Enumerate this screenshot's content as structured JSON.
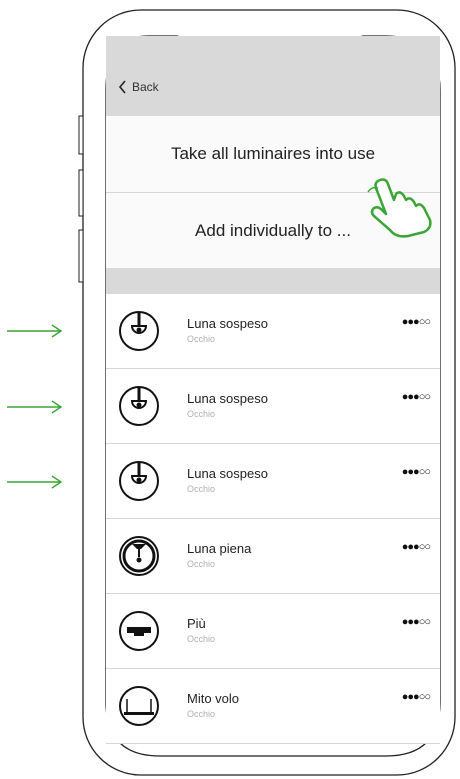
{
  "nav": {
    "back_label": "Back"
  },
  "actions": {
    "take_all_label": "Take all luminaires into use",
    "add_individually_label": "Add individually to ..."
  },
  "luminaires": [
    {
      "name": "Luna sospeso",
      "brand": "Occhio",
      "signal": "●●●○○",
      "icon": "luna-sospeso-icon"
    },
    {
      "name": "Luna sospeso",
      "brand": "Occhio",
      "signal": "●●●○○",
      "icon": "luna-sospeso-icon"
    },
    {
      "name": "Luna sospeso",
      "brand": "Occhio",
      "signal": "●●●○○",
      "icon": "luna-sospeso-icon"
    },
    {
      "name": "Luna piena",
      "brand": "Occhio",
      "signal": "●●●○○",
      "icon": "luna-piena-icon"
    },
    {
      "name": "Più",
      "brand": "Occhio",
      "signal": "●●●○○",
      "icon": "piu-icon"
    },
    {
      "name": "Mito volo",
      "brand": "Occhio",
      "signal": "●●●○○",
      "icon": "mito-volo-icon"
    }
  ],
  "colors": {
    "accent_green": "#3aa635",
    "bar_gray": "#d9d9d9"
  }
}
